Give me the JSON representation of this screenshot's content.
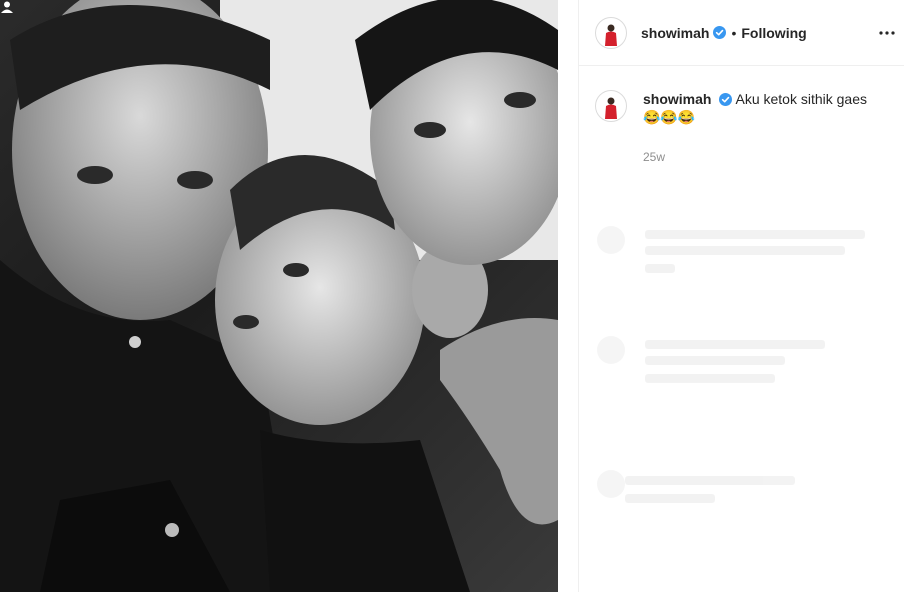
{
  "post": {
    "username": "showimah",
    "follow_status": "Following",
    "separator": "•",
    "caption": "Aku ketok sithik gaes😂😂😂",
    "timestamp": "25w"
  },
  "icons": {
    "verified": "verified-badge-icon",
    "more": "more-options-icon",
    "user_tag": "user-tag-icon"
  },
  "colors": {
    "verified_blue": "#3897f0",
    "avatar_red": "#d4202c",
    "border": "#efefef",
    "muted": "#8e8e8e"
  }
}
